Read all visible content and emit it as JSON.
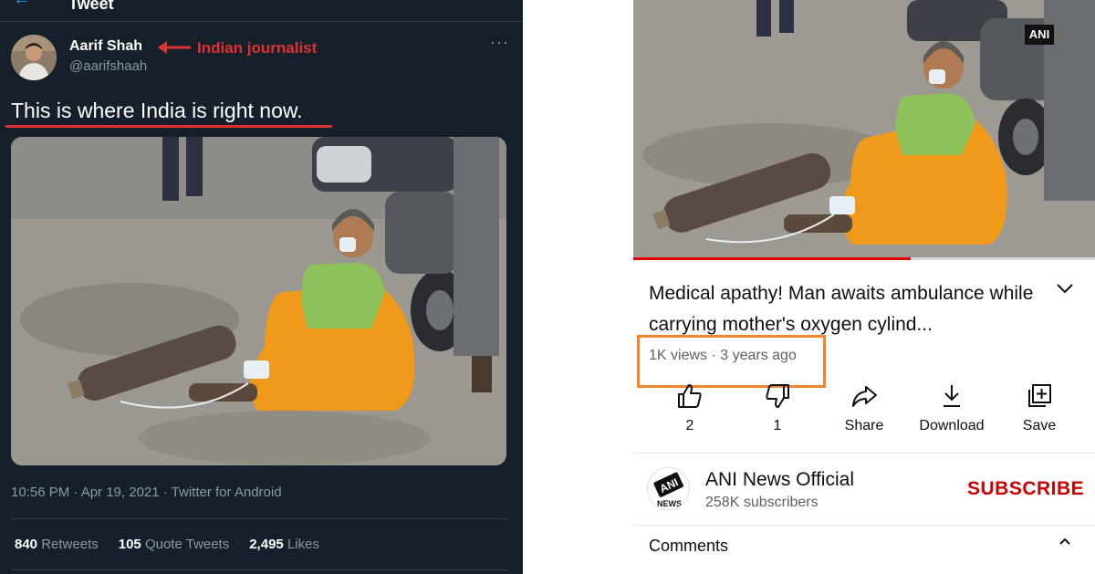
{
  "colors": {
    "twitter_bg": "#15202b",
    "annotation_red": "#e03131",
    "highlight_orange": "#f0852d",
    "subscribe_red": "#cc0000",
    "progress_red": "#e00000"
  },
  "twitter": {
    "header_title": "Tweet",
    "author": {
      "name": "Aarif Shah",
      "handle": "@aarifshaah"
    },
    "annotation": "Indian journalist",
    "text": "This is where India is right now.",
    "meta": "10:56 PM · Apr 19, 2021 · Twitter for Android",
    "stats": [
      {
        "count": "840",
        "label": "Retweets"
      },
      {
        "count": "105",
        "label": "Quote Tweets"
      },
      {
        "count": "2,495",
        "label": "Likes"
      }
    ],
    "icons": [
      "back-arrow-icon",
      "more-icon"
    ]
  },
  "youtube": {
    "video_badge": "ANI",
    "progress_fraction": 0.6,
    "title": "Medical apathy! Man awaits ambulance while carrying mother's oxygen cylind...",
    "meta": "1K views · 3 years ago",
    "actions": [
      {
        "icon": "thumbs-up-icon",
        "label": "2"
      },
      {
        "icon": "thumbs-down-icon",
        "label": "1"
      },
      {
        "icon": "share-icon",
        "label": "Share"
      },
      {
        "icon": "download-icon",
        "label": "Download"
      },
      {
        "icon": "save-icon",
        "label": "Save"
      }
    ],
    "channel": {
      "name": "ANI News Official",
      "subscribers": "258K subscribers",
      "logo_text": "ANI",
      "logo_subtext": "NEWS"
    },
    "subscribe_label": "SUBSCRIBE",
    "comments_label": "Comments"
  }
}
